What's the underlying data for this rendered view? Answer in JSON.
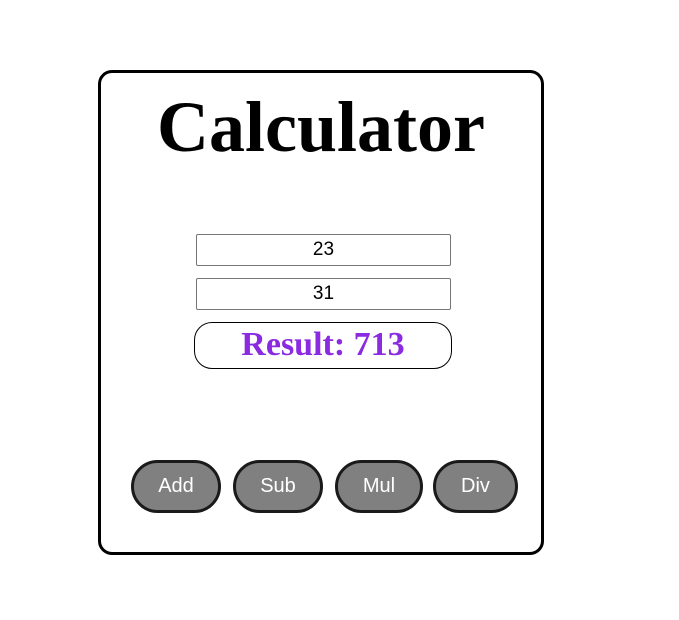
{
  "calculator": {
    "title": "Calculator",
    "first_number": "23",
    "second_number": "31",
    "result_text": "Result: 713",
    "buttons": {
      "add": "Add",
      "sub": "Sub",
      "mul": "Mul",
      "div": "Div"
    }
  },
  "colors": {
    "result_text": "#8a2be2",
    "button_background": "#808080",
    "button_text": "#ffffff",
    "card_border": "#000000"
  }
}
